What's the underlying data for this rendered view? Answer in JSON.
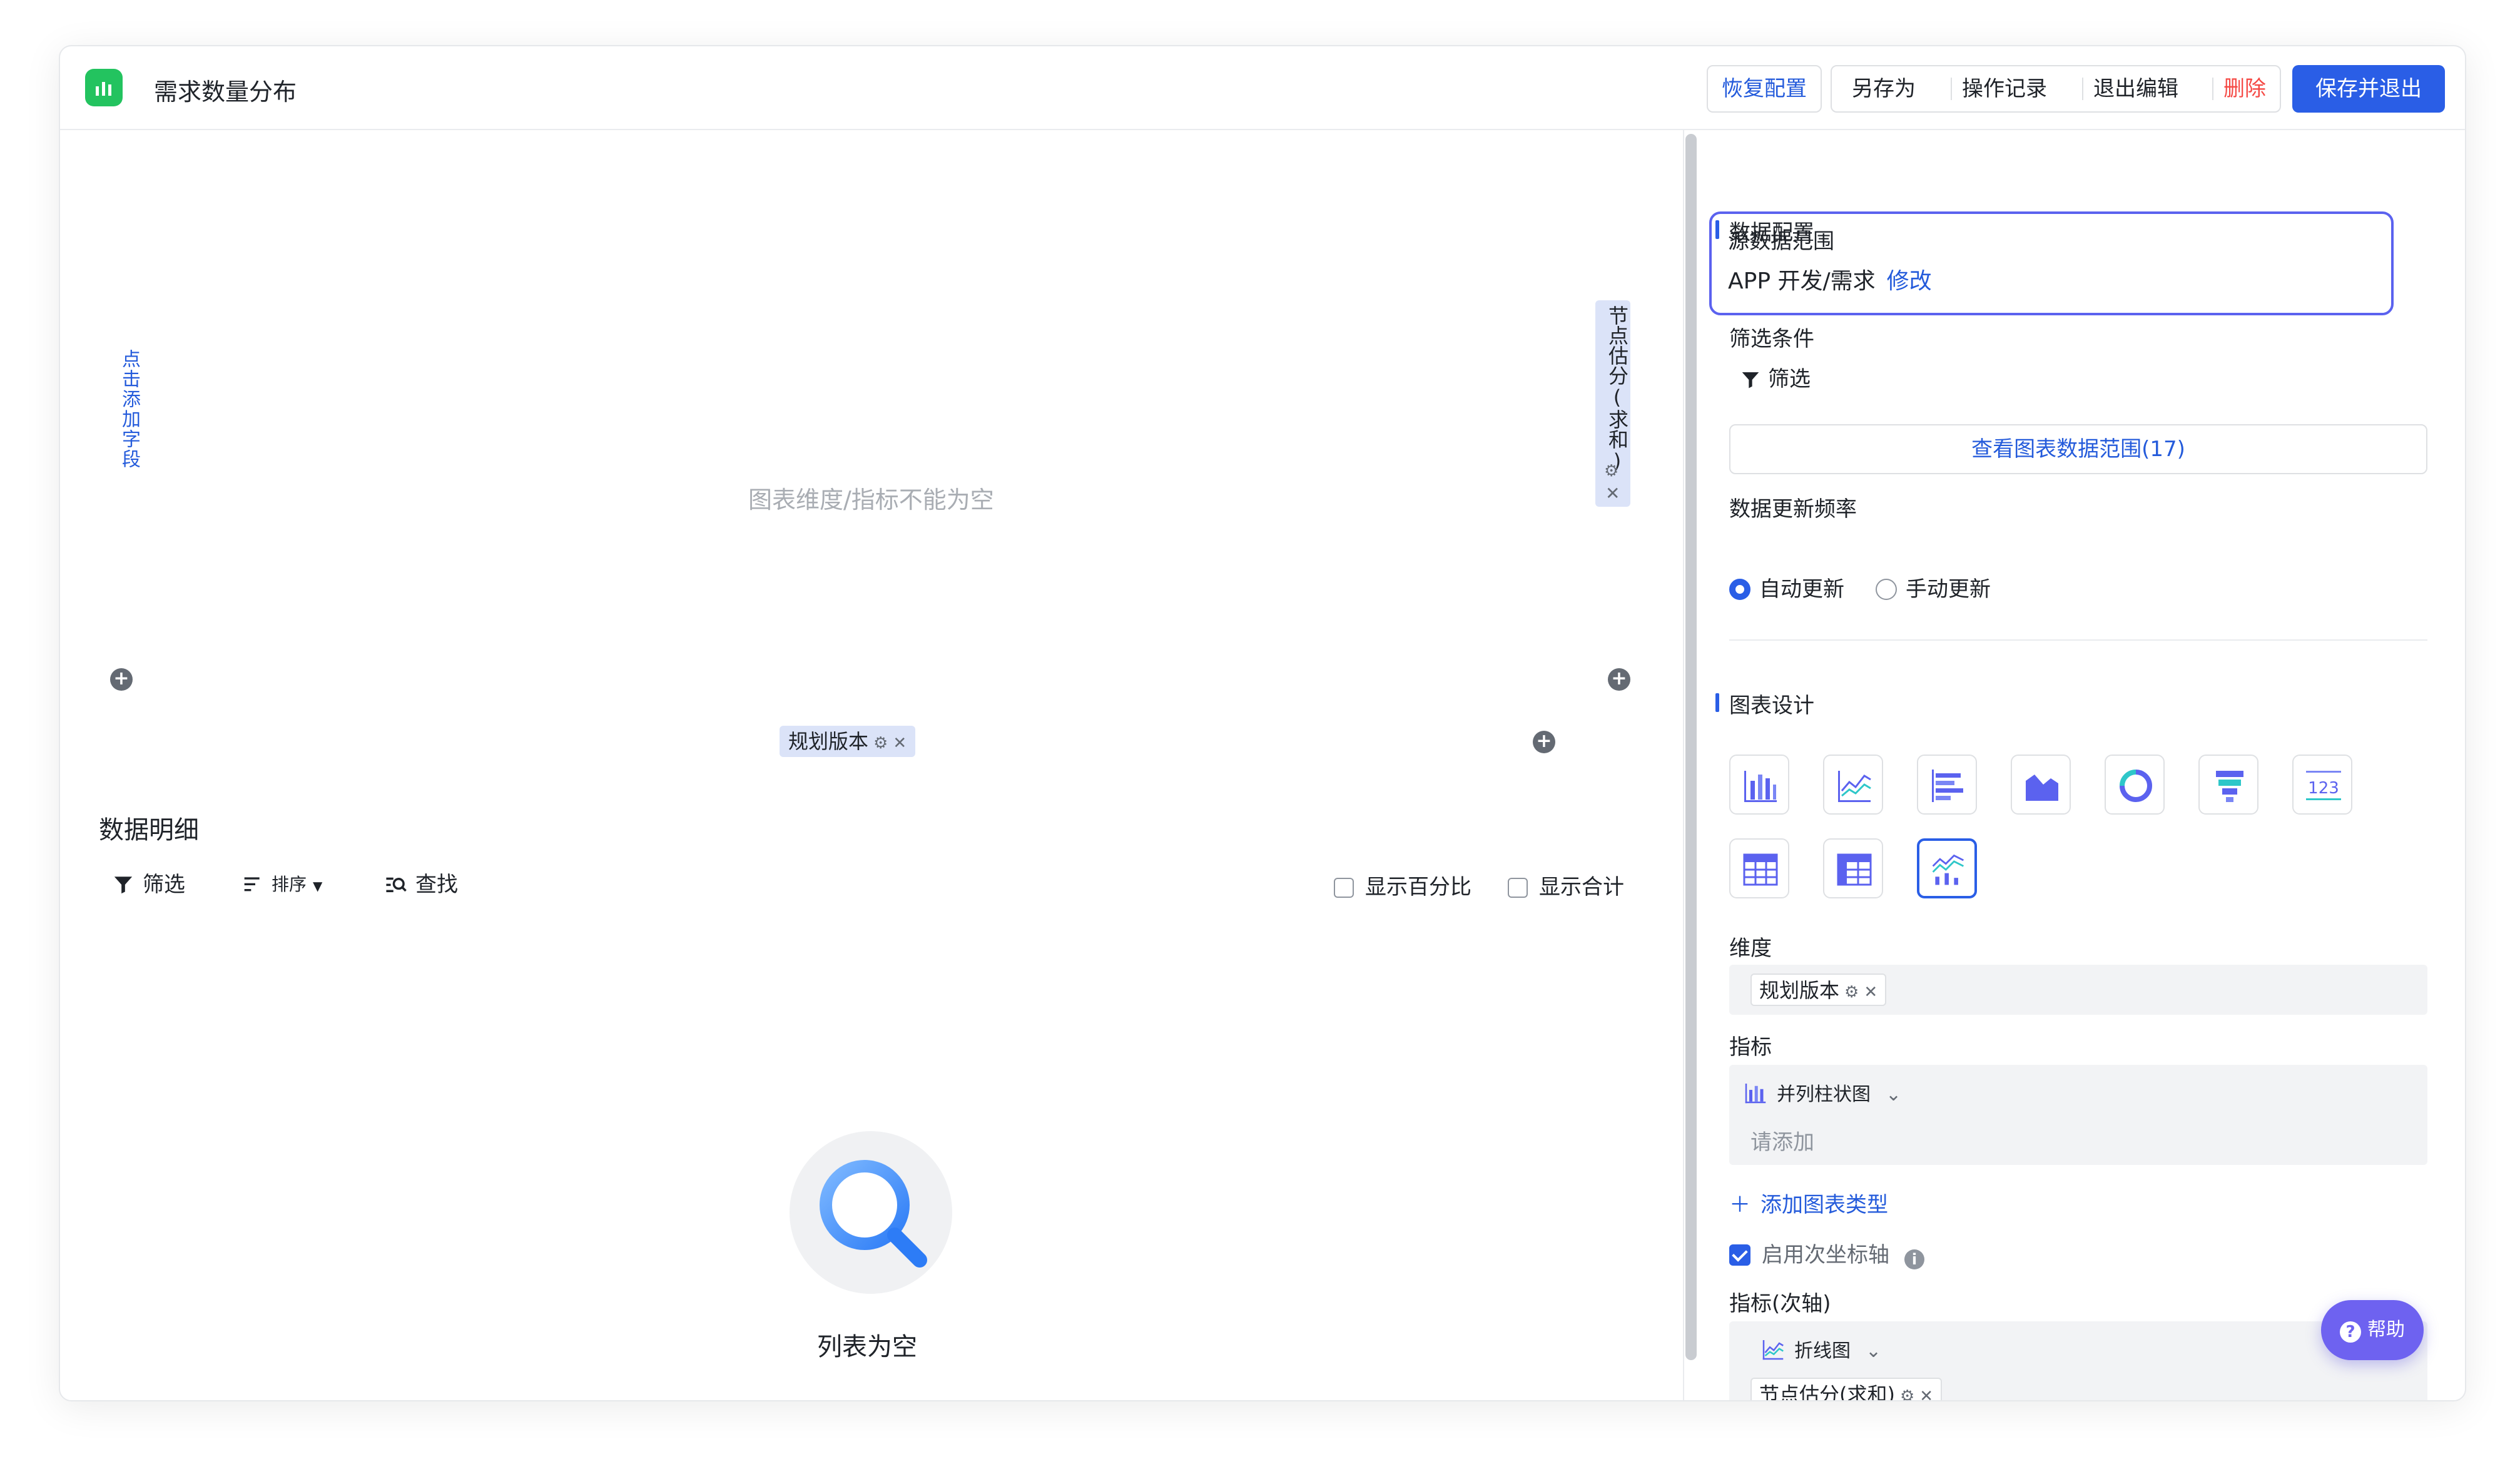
{
  "header": {
    "title": "需求数量分布",
    "restore_label": "恢复配置",
    "save_as_label": "另存为",
    "history_label": "操作记录",
    "exit_edit_label": "退出编辑",
    "delete_label": "删除",
    "save_exit_label": "保存并退出"
  },
  "canvas": {
    "add_field_label": "点击添加字段",
    "y2_field_label": "节点估分(求和)",
    "empty_message": "图表维度/指标不能为空",
    "x_field_label": "规划版本"
  },
  "detail": {
    "title": "数据明细",
    "filter_label": "筛选",
    "sort_label": "排序",
    "find_label": "查找",
    "show_percent_label": "显示百分比",
    "show_total_label": "显示合计",
    "empty_list_label": "列表为空"
  },
  "panel": {
    "data_config_title": "数据配置",
    "source_range_label": "源数据范围",
    "source_range_value": "APP 开发/需求",
    "modify_label": "修改",
    "filter_conditions_label": "筛选条件",
    "filter_label": "筛选",
    "view_range_label": "查看图表数据范围(17)",
    "update_freq_label": "数据更新频率",
    "auto_update_label": "自动更新",
    "manual_update_label": "手动更新",
    "chart_design_title": "图表设计",
    "dimension_label": "维度",
    "dimension_value": "规划版本",
    "metric_label": "指标",
    "metric_chart_type": "并列柱状图",
    "metric_placeholder": "请添加",
    "add_chart_type_label": "添加图表类型",
    "secondary_axis_label": "启用次坐标轴",
    "secondary_metric_label": "指标(次轴)",
    "secondary_chart_type": "折线图",
    "secondary_metric_value": "节点估分(求和)"
  },
  "help_label": "帮助",
  "colors": {
    "primary": "#2a5ee6",
    "danger": "#f54a45",
    "app_icon": "#23c35f",
    "help": "#6e62f0"
  }
}
